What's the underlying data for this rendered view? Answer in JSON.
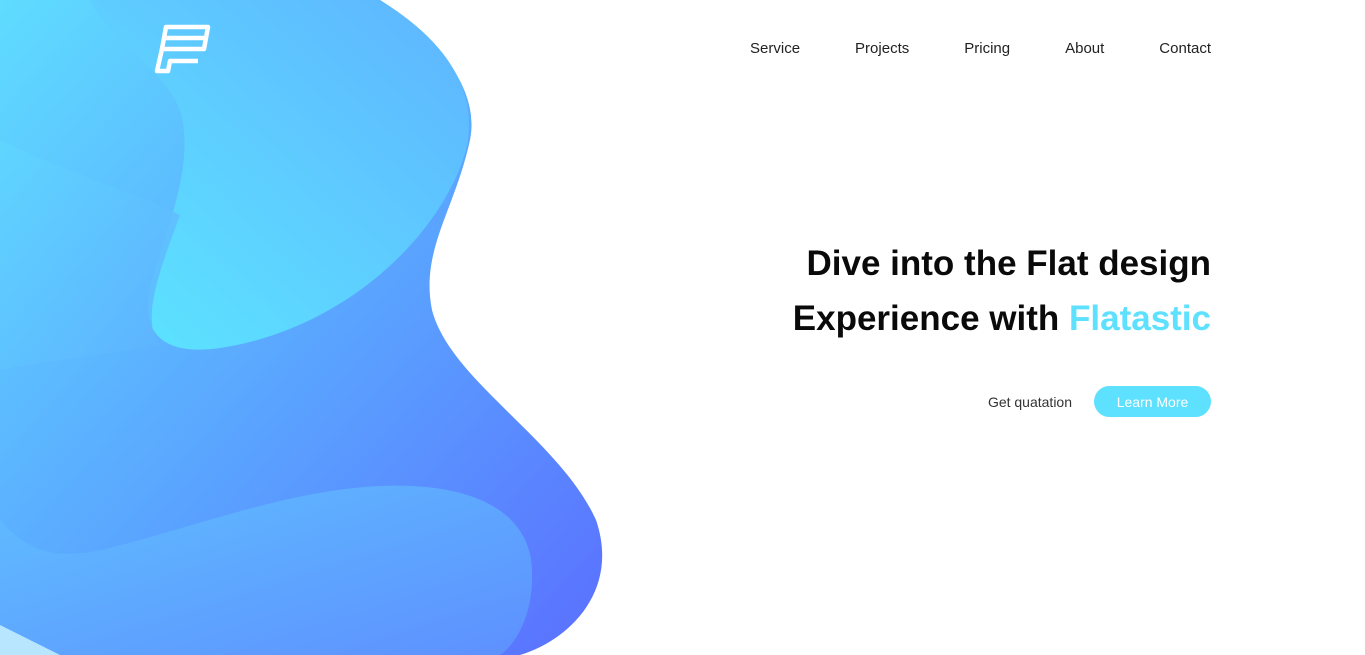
{
  "brand": {
    "logo_icon": "flatastic-logo-icon",
    "accent_color": "#5ee0ff"
  },
  "nav": {
    "items": [
      {
        "label": "Service"
      },
      {
        "label": "Projects"
      },
      {
        "label": "Pricing"
      },
      {
        "label": "About"
      },
      {
        "label": "Contact"
      }
    ]
  },
  "hero": {
    "line1": "Dive into the Flat design",
    "line2_prefix": "Experience with",
    "line2_brand": "Flatastic"
  },
  "actions": {
    "quote_label": "Get quatation",
    "learn_label": "Learn More"
  },
  "colors": {
    "blob_light": "#5ee4ff",
    "blob_dark": "#5a78ff",
    "text": "#0a0a0a"
  }
}
